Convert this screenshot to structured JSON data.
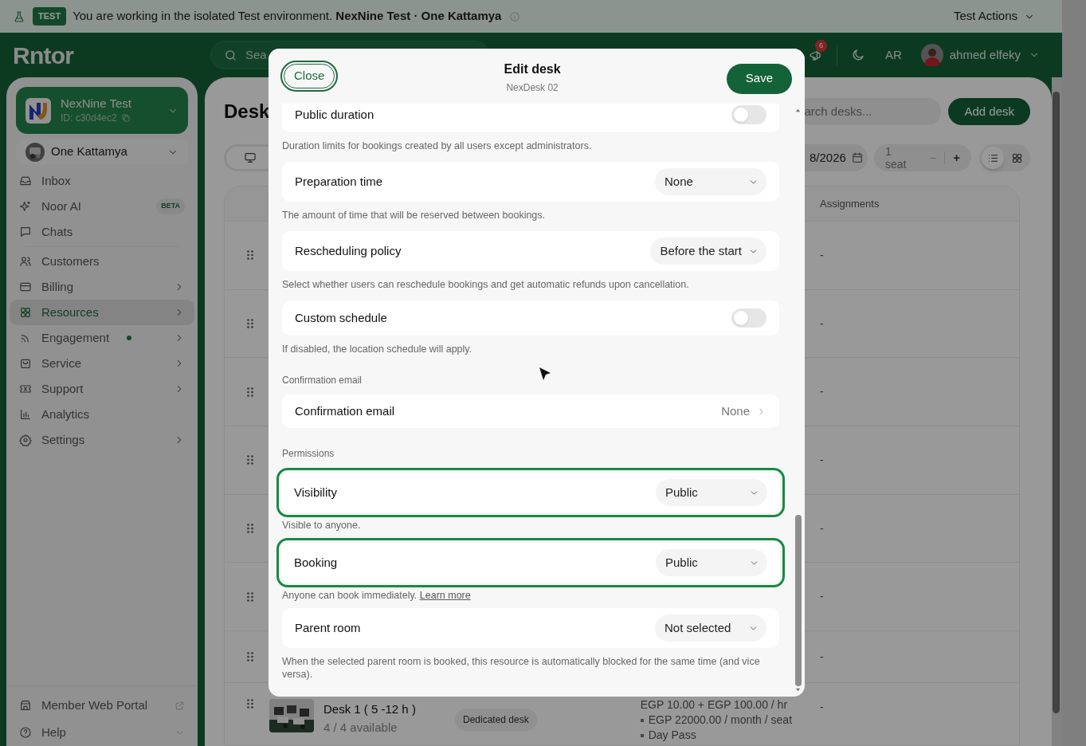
{
  "banner": {
    "badge": "TEST",
    "message": "You are working in the isolated Test environment. **NexNine Test · One Kattamya**",
    "action": "Test Actions"
  },
  "header": {
    "logo": "Rntor",
    "search_placeholder": "Sea",
    "notification_count": "6",
    "language": "AR",
    "user": "ahmed elfeky"
  },
  "sidebar": {
    "org": {
      "name": "NexNine Test",
      "id": "ID: c30d4ec2"
    },
    "location": "One Kattamya",
    "groups": [
      [
        {
          "label": "Inbox",
          "selected": false,
          "submenu": false,
          "dot": false
        },
        {
          "label": "Noor AI",
          "selected": false,
          "submenu": false,
          "dot": false,
          "badge": "BETA"
        },
        {
          "label": "Chats",
          "selected": false,
          "submenu": false,
          "dot": false
        }
      ],
      [
        {
          "label": "Customers",
          "selected": false,
          "submenu": false,
          "dot": false
        },
        {
          "label": "Billing",
          "selected": false,
          "submenu": true,
          "dot": false
        },
        {
          "label": "Resources",
          "selected": true,
          "submenu": true,
          "dot": false
        },
        {
          "label": "Engagement",
          "selected": false,
          "submenu": true,
          "dot": true
        },
        {
          "label": "Service",
          "selected": false,
          "submenu": true,
          "dot": false
        },
        {
          "label": "Support",
          "selected": false,
          "submenu": true,
          "dot": false
        },
        {
          "label": "Analytics",
          "selected": false,
          "submenu": false,
          "dot": false
        },
        {
          "label": "Settings",
          "selected": false,
          "submenu": true,
          "dot": false
        }
      ]
    ],
    "footer": [
      {
        "label": "Member Web Portal"
      },
      {
        "label": "Help"
      }
    ]
  },
  "page": {
    "title": "Desk",
    "search_placeholder": "arch desks...",
    "add_button": "Add desk",
    "date": "8/2026",
    "seats": {
      "value": "1",
      "unit": "seat",
      "decrement": "−",
      "increment": "+"
    },
    "view_list_selected": true,
    "columns": [
      "Assignments"
    ],
    "rows": [
      {
        "assignment": "-"
      },
      {
        "assignment": "-"
      },
      {
        "assignment": "-"
      },
      {
        "assignment": "-"
      },
      {
        "assignment": "-"
      },
      {
        "assignment": "-"
      },
      {
        "assignment": "-"
      },
      {
        "name": "Desk 1 ( 5 -12 h )",
        "availability": "4 / 4 available",
        "type": "Dedicated desk",
        "pricing": [
          "EGP 10.00 + EGP 100.00 / hr",
          "EGP 22000.00 / month / seat",
          "Day Pass"
        ],
        "assignment": "-"
      }
    ]
  },
  "modal": {
    "close": "Close",
    "title": "Edit desk",
    "subtitle": "NexDesk 02",
    "save": "Save",
    "fields": [
      {
        "kind": "toggle",
        "label": "Public duration",
        "on": false,
        "description": "Duration limits for bookings created by all users except administrators."
      },
      {
        "kind": "select",
        "label": "Preparation time",
        "value": "None",
        "highlighted": false,
        "description": "The amount of time that will be reserved between bookings."
      },
      {
        "kind": "select",
        "label": "Rescheduling policy",
        "value": "Before the start",
        "highlighted": false,
        "description": "Select whether users can reschedule bookings and get automatic refunds upon cancellation."
      },
      {
        "kind": "toggle",
        "label": "Custom schedule",
        "on": false,
        "description": "If disabled, the location schedule will apply."
      },
      {
        "kind": "heading",
        "label": "Confirmation email"
      },
      {
        "kind": "link",
        "label": "Confirmation email",
        "value": "None"
      },
      {
        "kind": "heading",
        "label": "Permissions"
      },
      {
        "kind": "select",
        "label": "Visibility",
        "value": "Public",
        "highlighted": true,
        "description": "Visible to anyone."
      },
      {
        "kind": "select",
        "label": "Booking",
        "value": "Public",
        "highlighted": true,
        "description": "Anyone can book immediately.",
        "link": "Learn more"
      },
      {
        "kind": "select",
        "label": "Parent room",
        "value": "Not selected",
        "highlighted": false,
        "description": "When the selected parent room is booked, this resource is automatically blocked for the same time (and vice versa)."
      }
    ]
  }
}
